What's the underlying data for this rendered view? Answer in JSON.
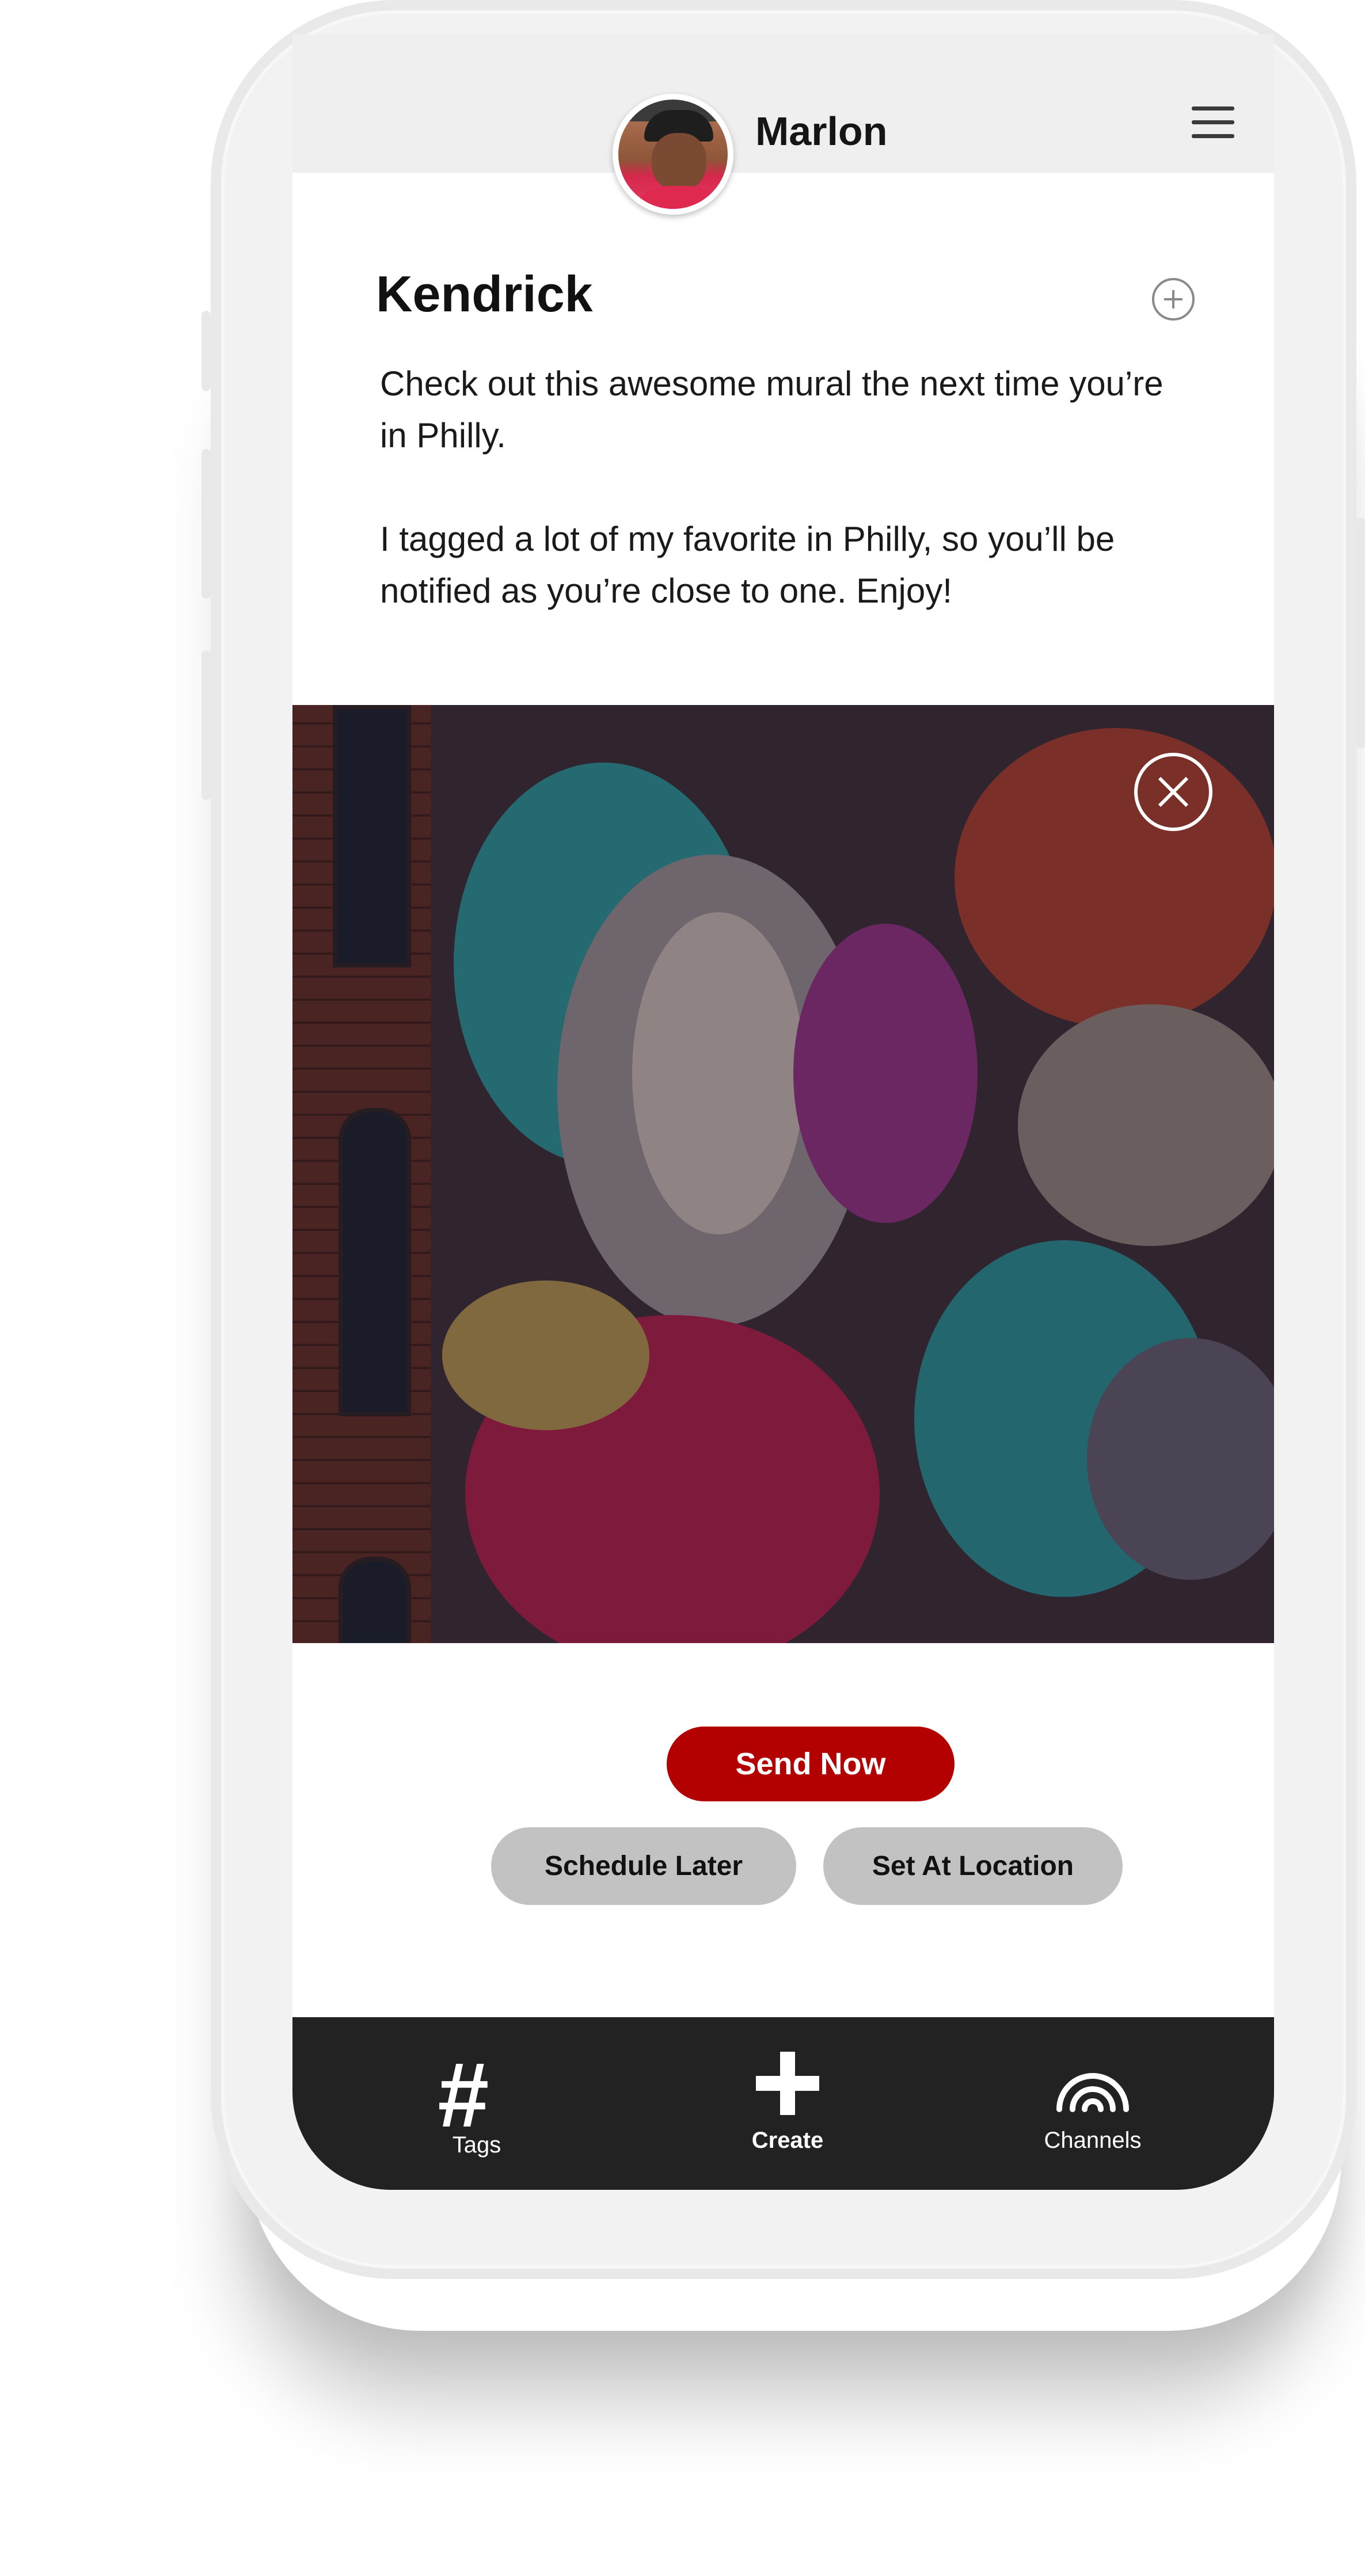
{
  "header": {
    "user_name": "Marlon"
  },
  "post": {
    "title": "Kendrick",
    "paragraphs": [
      "Check out this awesome mural the next time you’re in Philly.",
      "I tagged a lot of my favorite in Philly, so you’ll be notified as you’re close to one. Enjoy!"
    ]
  },
  "actions": {
    "send_now": "Send Now",
    "schedule_later": "Schedule Later",
    "set_at_location": "Set At Location"
  },
  "nav": {
    "tags": "Tags",
    "create": "Create",
    "channels": "Channels"
  },
  "icons": [
    "menu-icon",
    "add-circle-icon",
    "close-circle-icon",
    "hashtag-icon",
    "plus-icon",
    "broadcast-icon"
  ],
  "colors": {
    "accent": "#b30000",
    "nav_background": "#222222",
    "secondary_button": "#c2c2c2",
    "phone_frame": "#f2f2f2"
  }
}
